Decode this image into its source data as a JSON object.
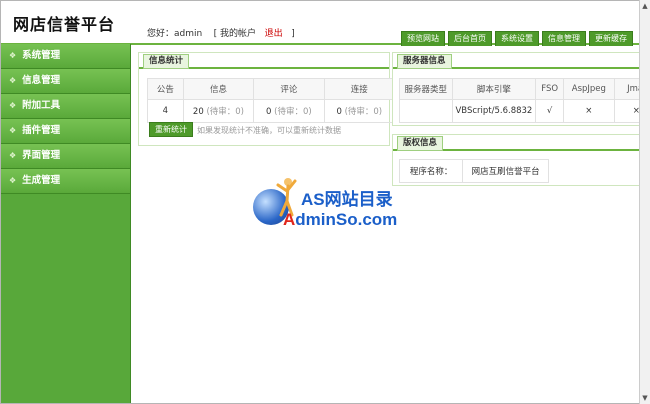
{
  "header": {
    "logo": "网店信誉平台",
    "greeting": "您好：admin",
    "account_link": "[ 我的帐户",
    "logout_link": "退出",
    "account_close": "]"
  },
  "topnav": [
    "预览网站",
    "后台首页",
    "系统设置",
    "信息管理",
    "更新缓存"
  ],
  "sidebar": {
    "items": [
      {
        "label": "系统管理"
      },
      {
        "label": "信息管理"
      },
      {
        "label": "附加工具"
      },
      {
        "label": "插件管理"
      },
      {
        "label": "界面管理"
      },
      {
        "label": "生成管理"
      }
    ]
  },
  "stats": {
    "title": "信息统计",
    "headers": [
      "公告",
      "信息",
      "评论",
      "连接"
    ],
    "row": {
      "notice": "4",
      "info_count": "20",
      "info_pending": "(待审：0)",
      "comment_count": "0",
      "comment_pending": "(待审：0)",
      "link_count": "0",
      "link_pending": "(待审：0)"
    },
    "refresh_button": "重新统计",
    "hint": "如果发现统计不准确，可以重新统计数据"
  },
  "server": {
    "title": "服务器信息",
    "headers": [
      "服务器类型",
      "脚本引擎",
      "FSO",
      "AspJpeg",
      "Jmai"
    ],
    "row": [
      "",
      "VBScript/5.6.8832",
      "√",
      "×",
      "×"
    ]
  },
  "copyright": {
    "title": "版权信息",
    "label": "程序名称：",
    "value": "网店互刷信誉平台"
  },
  "watermark": {
    "line1": "AS网站目录",
    "line2_red": "A",
    "line2_blue": "dminSo.com"
  },
  "colors": {
    "accent_green": "#6cb33f",
    "sidebar_green": "#58a83a",
    "logout_red": "#cc0000",
    "watermark_blue": "#1b5fc9"
  }
}
